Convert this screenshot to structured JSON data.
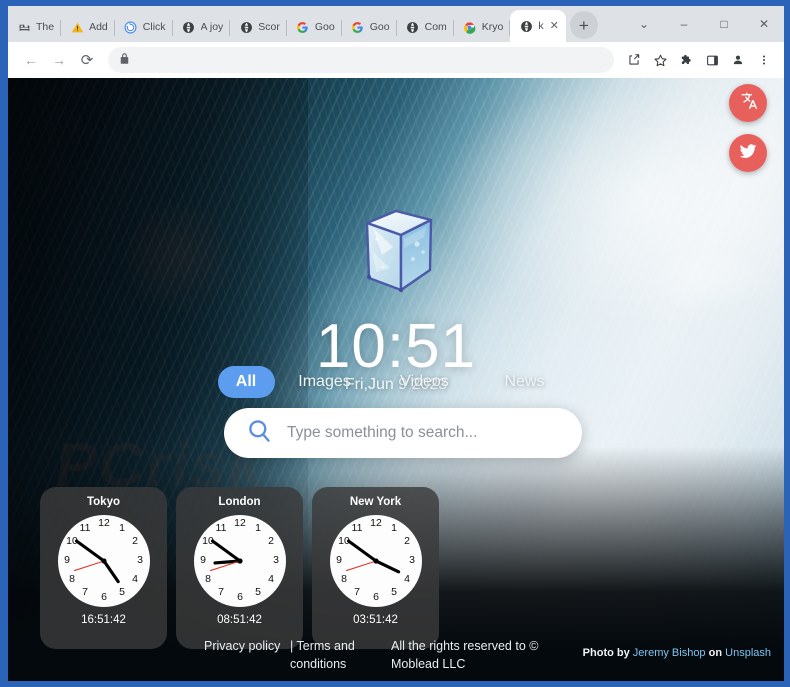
{
  "browser": {
    "tabs": [
      {
        "label": "The ",
        "icon": "bed-icon"
      },
      {
        "label": "Add",
        "icon": "warning-icon"
      },
      {
        "label": "Click",
        "icon": "chrome-blue-icon"
      },
      {
        "label": "A joy",
        "icon": "globe-icon"
      },
      {
        "label": "Scor",
        "icon": "globe-icon"
      },
      {
        "label": "Goo",
        "icon": "google-icon"
      },
      {
        "label": "Goo",
        "icon": "google-icon"
      },
      {
        "label": "Com",
        "icon": "globe-icon"
      },
      {
        "label": "Kryo",
        "icon": "chrome-icon"
      },
      {
        "label": "k",
        "icon": "globe-icon",
        "active": true
      }
    ],
    "new_tab_label": "+",
    "tab_close_label": "✕",
    "window_controls": [
      {
        "name": "tab-search",
        "glyph": "⌄"
      },
      {
        "name": "minimize",
        "glyph": "–"
      },
      {
        "name": "maximize",
        "glyph": "□"
      },
      {
        "name": "close",
        "glyph": "✕"
      }
    ],
    "nav": {
      "back": "←",
      "forward": "→",
      "reload": "⟳",
      "lock": "🔒",
      "url": "",
      "url_placeholder": ""
    },
    "toolbar_icons": [
      {
        "name": "share-icon",
        "glyph": "⤴"
      },
      {
        "name": "bookmark-star-icon",
        "glyph": "☆"
      },
      {
        "name": "extensions-puzzle-icon",
        "glyph": "❖"
      },
      {
        "name": "side-panel-icon",
        "glyph": "□"
      },
      {
        "name": "profile-avatar-icon",
        "glyph": "●"
      },
      {
        "name": "chrome-menu-icon",
        "glyph": "⋮"
      }
    ]
  },
  "page": {
    "logo_alt": "ice-cube-logo",
    "time": "10:51",
    "date": "Fri,Jun 9 2023",
    "categories": [
      {
        "label": "All",
        "active": true
      },
      {
        "label": "Images",
        "active": false
      },
      {
        "label": "Videos",
        "active": false
      },
      {
        "label": "News",
        "active": false
      }
    ],
    "search": {
      "value": "",
      "placeholder": "Type something to search...",
      "icon": "search-icon"
    },
    "fabs": [
      {
        "name": "translate-button",
        "icon": "translate-icon"
      },
      {
        "name": "twitter-button",
        "icon": "twitter-icon"
      }
    ],
    "world_clocks": [
      {
        "city": "Tokyo",
        "time": "16:51:42",
        "hour_deg": 145.5,
        "minute_deg": 306,
        "second_deg": 252
      },
      {
        "city": "London",
        "time": "08:51:42",
        "hour_deg": 265.5,
        "minute_deg": 306,
        "second_deg": 252
      },
      {
        "city": "New York",
        "time": "03:51:42",
        "hour_deg": 115.5,
        "minute_deg": 306,
        "second_deg": 252
      }
    ],
    "footer": {
      "privacy": "Privacy policy",
      "terms": "| Terms and conditions",
      "rights": "All the rights reserved to © Moblead LLC"
    },
    "credit": {
      "photo_by": "Photo by",
      "author": "Jeremy Bishop",
      "on": "on",
      "source": "Unsplash"
    },
    "watermark": "PCrisk"
  },
  "colors": {
    "window_frame": "#2a63b8",
    "tabstrip": "#dee1e6",
    "accent_blue": "#5c9df0",
    "fab_red": "#e8605c",
    "link_blue": "#7fc5f0",
    "clock_card": "rgba(58,58,58,.82)"
  }
}
